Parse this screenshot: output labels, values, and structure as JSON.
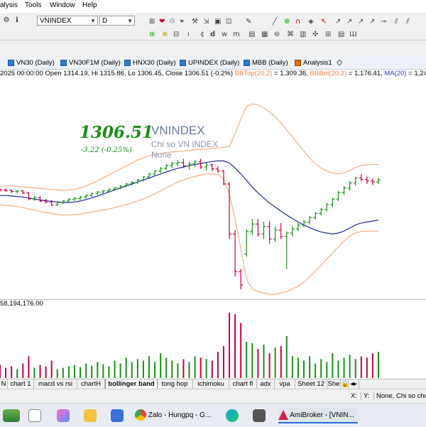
{
  "menu": {
    "items": [
      "alysis",
      "Tools",
      "Window",
      "Help"
    ]
  },
  "toolbar": {
    "symbol": "VNINDEX",
    "interval": "D"
  },
  "chart_tabs": [
    {
      "label": "VN30 (Daily)"
    },
    {
      "label": "VN30F1M (Daily)"
    },
    {
      "label": "HNX30 (Daily)"
    },
    {
      "label": "UPINDEX (Daily)"
    },
    {
      "label": "MBB (Daily)"
    },
    {
      "label": "Analysis1"
    }
  ],
  "info_line": {
    "prefix": "2025 00:00:00 Open 1314.19, Hi 1315.86, Lo 1306.45, Close 1306.51 (-0.2%) ",
    "bbtop_label": "BBTop(20,2)",
    "bbtop_value": " = 1,309.36, ",
    "bbbot_label": "BBBot(20,2)",
    "bbbot_value": " = 1,176.41, ",
    "ma_label": "MA(20)",
    "ma_value": " = 1,24"
  },
  "chart_overlay": {
    "price": "1306.51",
    "symbol": "VNINDEX",
    "change": "-3.22 (-0.25%)",
    "desc": "Chi so VN INDEX",
    "sector": "None"
  },
  "volume_pane": {
    "label": "58,194,176.00"
  },
  "sheet_tabs": [
    "N",
    "chart 1",
    "macd vs rsi",
    "chartH",
    "bollinger band",
    "tong hop",
    "ichimoku",
    "chart fl",
    "adx",
    "vpa",
    "Sheet 12",
    "She"
  ],
  "active_sheet": "bollinger band",
  "status": {
    "x": "X:",
    "y": "Y:",
    "text": "None, Chi so chu"
  },
  "taskbar": {
    "zalo": "Zalo - Hungpq - G...",
    "amibroker": "AmiBroker - [VNIN..."
  },
  "colors": {
    "up": "#1a8f1a",
    "down": "#c8003c",
    "bband": "#f3a46c",
    "ma": "#1f2a9a",
    "ma_label": "#3333cc",
    "bb_label": "#f08040"
  },
  "chart_data": {
    "type": "candlestick",
    "title": "",
    "ohlc": [
      {
        "o": 1259,
        "h": 1262,
        "l": 1255,
        "c": 1258
      },
      {
        "o": 1258,
        "h": 1261,
        "l": 1254,
        "c": 1257
      },
      {
        "o": 1257,
        "h": 1259,
        "l": 1252,
        "c": 1255
      },
      {
        "o": 1255,
        "h": 1258,
        "l": 1251,
        "c": 1256
      },
      {
        "o": 1256,
        "h": 1258,
        "l": 1250,
        "c": 1252
      },
      {
        "o": 1252,
        "h": 1254,
        "l": 1238,
        "c": 1240
      },
      {
        "o": 1240,
        "h": 1246,
        "l": 1236,
        "c": 1243
      },
      {
        "o": 1243,
        "h": 1245,
        "l": 1234,
        "c": 1236
      },
      {
        "o": 1236,
        "h": 1240,
        "l": 1231,
        "c": 1234
      },
      {
        "o": 1234,
        "h": 1238,
        "l": 1226,
        "c": 1228
      },
      {
        "o": 1228,
        "h": 1236,
        "l": 1226,
        "c": 1233
      },
      {
        "o": 1233,
        "h": 1238,
        "l": 1230,
        "c": 1236
      },
      {
        "o": 1236,
        "h": 1242,
        "l": 1233,
        "c": 1239
      },
      {
        "o": 1239,
        "h": 1244,
        "l": 1236,
        "c": 1241
      },
      {
        "o": 1241,
        "h": 1246,
        "l": 1238,
        "c": 1244
      },
      {
        "o": 1244,
        "h": 1249,
        "l": 1241,
        "c": 1247
      },
      {
        "o": 1247,
        "h": 1253,
        "l": 1244,
        "c": 1251
      },
      {
        "o": 1251,
        "h": 1256,
        "l": 1248,
        "c": 1254
      },
      {
        "o": 1254,
        "h": 1258,
        "l": 1250,
        "c": 1256
      },
      {
        "o": 1256,
        "h": 1261,
        "l": 1253,
        "c": 1259
      },
      {
        "o": 1259,
        "h": 1264,
        "l": 1256,
        "c": 1262
      },
      {
        "o": 1262,
        "h": 1268,
        "l": 1259,
        "c": 1266
      },
      {
        "o": 1266,
        "h": 1272,
        "l": 1263,
        "c": 1270
      },
      {
        "o": 1270,
        "h": 1276,
        "l": 1267,
        "c": 1273
      },
      {
        "o": 1273,
        "h": 1280,
        "l": 1270,
        "c": 1278
      },
      {
        "o": 1278,
        "h": 1286,
        "l": 1275,
        "c": 1284
      },
      {
        "o": 1284,
        "h": 1292,
        "l": 1280,
        "c": 1290
      },
      {
        "o": 1290,
        "h": 1298,
        "l": 1286,
        "c": 1296
      },
      {
        "o": 1296,
        "h": 1304,
        "l": 1292,
        "c": 1301
      },
      {
        "o": 1301,
        "h": 1310,
        "l": 1297,
        "c": 1307
      },
      {
        "o": 1307,
        "h": 1314,
        "l": 1302,
        "c": 1311
      },
      {
        "o": 1311,
        "h": 1318,
        "l": 1305,
        "c": 1313
      },
      {
        "o": 1313,
        "h": 1320,
        "l": 1302,
        "c": 1306
      },
      {
        "o": 1306,
        "h": 1314,
        "l": 1298,
        "c": 1310
      },
      {
        "o": 1310,
        "h": 1318,
        "l": 1304,
        "c": 1314
      },
      {
        "o": 1314,
        "h": 1320,
        "l": 1300,
        "c": 1304
      },
      {
        "o": 1304,
        "h": 1312,
        "l": 1296,
        "c": 1308
      },
      {
        "o": 1308,
        "h": 1311,
        "l": 1296,
        "c": 1300
      },
      {
        "o": 1300,
        "h": 1305,
        "l": 1292,
        "c": 1296
      },
      {
        "o": 1296,
        "h": 1298,
        "l": 1268,
        "c": 1270
      },
      {
        "o": 1270,
        "h": 1274,
        "l": 1160,
        "c": 1170
      },
      {
        "o": 1170,
        "h": 1178,
        "l": 1085,
        "c": 1095
      },
      {
        "o": 1095,
        "h": 1100,
        "l": 1060,
        "c": 1068
      },
      {
        "o": 1130,
        "h": 1180,
        "l": 1125,
        "c": 1175
      },
      {
        "o": 1175,
        "h": 1200,
        "l": 1168,
        "c": 1190
      },
      {
        "o": 1190,
        "h": 1200,
        "l": 1165,
        "c": 1170
      },
      {
        "o": 1170,
        "h": 1195,
        "l": 1160,
        "c": 1185
      },
      {
        "o": 1185,
        "h": 1196,
        "l": 1150,
        "c": 1160
      },
      {
        "o": 1160,
        "h": 1185,
        "l": 1155,
        "c": 1178
      },
      {
        "o": 1178,
        "h": 1192,
        "l": 1160,
        "c": 1165
      },
      {
        "o": 1165,
        "h": 1175,
        "l": 1100,
        "c": 1172
      },
      {
        "o": 1172,
        "h": 1186,
        "l": 1165,
        "c": 1180
      },
      {
        "o": 1180,
        "h": 1192,
        "l": 1176,
        "c": 1188
      },
      {
        "o": 1188,
        "h": 1198,
        "l": 1184,
        "c": 1194
      },
      {
        "o": 1194,
        "h": 1206,
        "l": 1190,
        "c": 1203
      },
      {
        "o": 1203,
        "h": 1214,
        "l": 1199,
        "c": 1211
      },
      {
        "o": 1211,
        "h": 1222,
        "l": 1207,
        "c": 1219
      },
      {
        "o": 1219,
        "h": 1232,
        "l": 1215,
        "c": 1229
      },
      {
        "o": 1229,
        "h": 1242,
        "l": 1224,
        "c": 1240
      },
      {
        "o": 1240,
        "h": 1256,
        "l": 1236,
        "c": 1253
      },
      {
        "o": 1253,
        "h": 1266,
        "l": 1248,
        "c": 1262
      },
      {
        "o": 1262,
        "h": 1276,
        "l": 1257,
        "c": 1272
      },
      {
        "o": 1272,
        "h": 1284,
        "l": 1267,
        "c": 1282
      },
      {
        "o": 1282,
        "h": 1290,
        "l": 1275,
        "c": 1279
      },
      {
        "o": 1279,
        "h": 1285,
        "l": 1270,
        "c": 1276
      },
      {
        "o": 1276,
        "h": 1281,
        "l": 1268,
        "c": 1274
      },
      {
        "o": 1274,
        "h": 1282,
        "l": 1270,
        "c": 1278
      }
    ],
    "volume": [
      18,
      14,
      16,
      12,
      20,
      30,
      14,
      18,
      16,
      24,
      12,
      14,
      16,
      18,
      15,
      20,
      17,
      22,
      19,
      16,
      24,
      20,
      28,
      22,
      26,
      24,
      30,
      22,
      34,
      28,
      24,
      20,
      26,
      22,
      30,
      28,
      26,
      24,
      36,
      44,
      90,
      88,
      76,
      50,
      48,
      40,
      46,
      34,
      42,
      44,
      58,
      30,
      28,
      24,
      30,
      20,
      26,
      22,
      34,
      24,
      28,
      32,
      26,
      30,
      28,
      34,
      36
    ],
    "bb_top": [
      1265,
      1266,
      1266,
      1265,
      1264,
      1263,
      1262,
      1261,
      1260,
      1259,
      1258,
      1257,
      1258,
      1259,
      1262,
      1266,
      1271,
      1276,
      1282,
      1288,
      1294,
      1300,
      1306,
      1312,
      1318,
      1322,
      1326,
      1329,
      1331,
      1333,
      1334,
      1335,
      1336,
      1337,
      1338,
      1339,
      1340,
      1341,
      1342,
      1343,
      1345,
      1370,
      1400,
      1425,
      1430,
      1428,
      1422,
      1414,
      1404,
      1392,
      1378,
      1364,
      1350,
      1336,
      1322,
      1310,
      1302,
      1296,
      1292,
      1290,
      1292,
      1297,
      1303,
      1307,
      1308,
      1309,
      1309
    ],
    "bb_bot": [
      1228,
      1227,
      1226,
      1225,
      1223,
      1220,
      1218,
      1215,
      1213,
      1211,
      1209,
      1208,
      1208,
      1209,
      1210,
      1212,
      1214,
      1216,
      1218,
      1220,
      1223,
      1226,
      1229,
      1232,
      1236,
      1240,
      1245,
      1250,
      1256,
      1262,
      1268,
      1274,
      1278,
      1282,
      1285,
      1288,
      1290,
      1290,
      1289,
      1280,
      1250,
      1200,
      1140,
      1080,
      1060,
      1055,
      1052,
      1050,
      1050,
      1052,
      1055,
      1060,
      1066,
      1074,
      1084,
      1096,
      1108,
      1120,
      1132,
      1144,
      1156,
      1166,
      1172,
      1175,
      1176,
      1176,
      1176
    ],
    "ma": [
      1247,
      1247,
      1246,
      1245,
      1244,
      1242,
      1240,
      1238,
      1237,
      1235,
      1234,
      1233,
      1233,
      1234,
      1236,
      1239,
      1242,
      1246,
      1250,
      1254,
      1258,
      1262,
      1266,
      1270,
      1274,
      1278,
      1282,
      1286,
      1290,
      1294,
      1298,
      1301,
      1304,
      1307,
      1309,
      1311,
      1313,
      1315,
      1316,
      1316,
      1312,
      1302,
      1290,
      1277,
      1264,
      1252,
      1242,
      1232,
      1224,
      1216,
      1208,
      1201,
      1194,
      1188,
      1183,
      1178,
      1174,
      1172,
      1170,
      1172,
      1176,
      1182,
      1188,
      1192,
      1194,
      1196,
      1198
    ],
    "ylim": [
      1040,
      1480
    ],
    "volume_max": 100
  }
}
